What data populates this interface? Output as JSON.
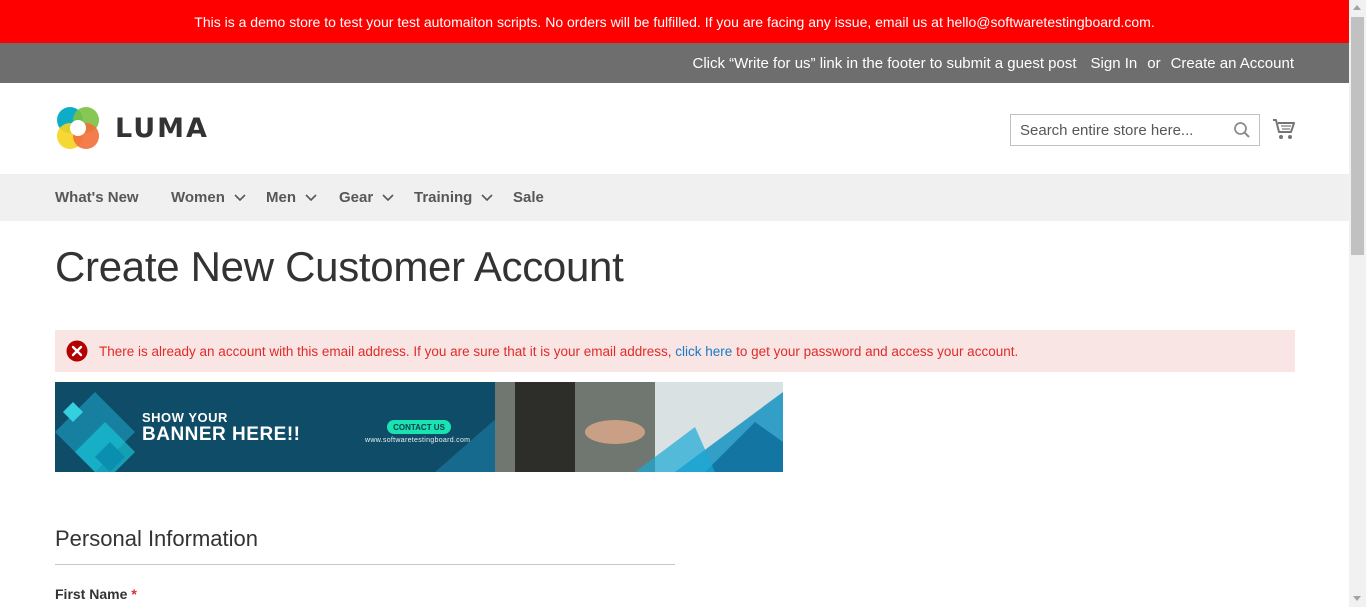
{
  "demo_notice": "This is a demo store to test your test automaiton scripts. No orders will be fulfilled. If you are facing any issue, email us at hello@softwaretestingboard.com.",
  "panel": {
    "guest_post_link": "Click “Write for us” link in the footer to submit a guest post",
    "sign_in": "Sign In",
    "or": "or",
    "create_account": "Create an Account"
  },
  "header": {
    "logo_text": "LUMA",
    "search_placeholder": "Search entire store here...",
    "search_icon": "search-icon",
    "cart_icon": "cart-icon"
  },
  "nav": {
    "items": [
      {
        "label": "What's New",
        "has_dropdown": false
      },
      {
        "label": "Women",
        "has_dropdown": true
      },
      {
        "label": "Men",
        "has_dropdown": true
      },
      {
        "label": "Gear",
        "has_dropdown": true
      },
      {
        "label": "Training",
        "has_dropdown": true
      },
      {
        "label": "Sale",
        "has_dropdown": false
      }
    ]
  },
  "page_title": "Create New Customer Account",
  "error": {
    "text_before": "There is already an account with this email address. If you are sure that it is your email address, ",
    "link": "click here",
    "text_after": " to get your password and access your account."
  },
  "banner": {
    "line1": "SHOW YOUR",
    "line2": "BANNER HERE!!",
    "contact": "CONTACT US",
    "url": "www.softwaretestingboard.com"
  },
  "form": {
    "section_title": "Personal Information",
    "first_name_label": "First Name",
    "required_mark": "*"
  },
  "colors": {
    "demo_bar": "#ff0000",
    "panel_bar": "#6e6e6e",
    "nav_bg": "#f0f0f0",
    "error_bg": "#fae5e5",
    "error_text": "#e02b27",
    "link": "#1979c3"
  }
}
